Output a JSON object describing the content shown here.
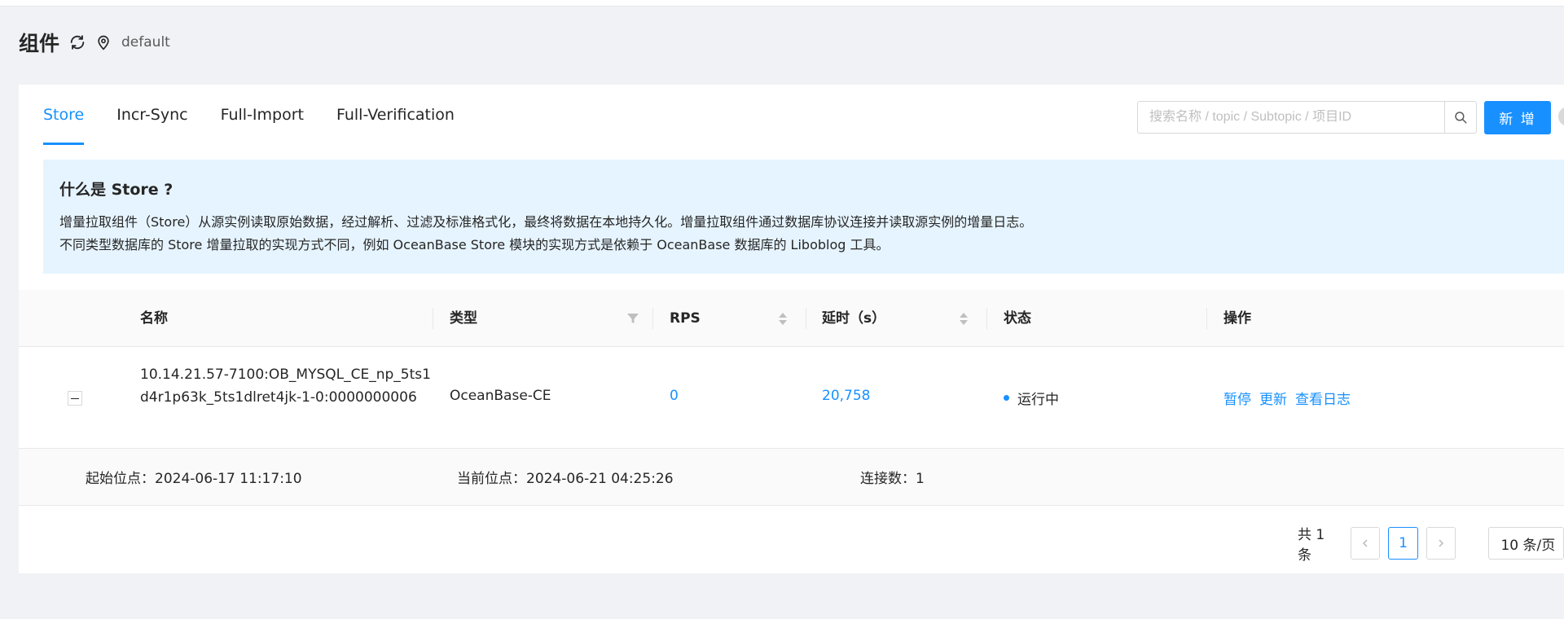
{
  "header": {
    "title": "组件",
    "refresh_icon": "refresh-icon",
    "location_icon": "location-pin-icon",
    "environment": "default"
  },
  "tabs": [
    {
      "label": "Store",
      "active": true
    },
    {
      "label": "Incr-Sync",
      "active": false
    },
    {
      "label": "Full-Import",
      "active": false
    },
    {
      "label": "Full-Verification",
      "active": false
    }
  ],
  "search": {
    "placeholder": "搜索名称 / topic / Subtopic / 项目ID",
    "value": "",
    "icon": "search-icon"
  },
  "add_button": {
    "label": "新 增"
  },
  "info": {
    "title": "什么是 Store ?",
    "line1": "增量拉取组件（Store）从源实例读取原始数据，经过解析、过滤及标准格式化，最终将数据在本地持久化。增量拉取组件通过数据库协议连接并读取源实例的增量日志。",
    "line2": "不同类型数据库的 Store 增量拉取的实现方式不同，例如 OceanBase Store 模块的实现方式是依赖于 OceanBase 数据库的 Liboblog 工具。"
  },
  "table": {
    "columns": {
      "name": "名称",
      "type": "类型",
      "rps": "RPS",
      "delay": "延时（s）",
      "status": "状态",
      "actions": "操作"
    },
    "rows": [
      {
        "name": "10.14.21.57-7100:OB_MYSQL_CE_np_5ts1d4r1p63k_5ts1dlret4jk-1-0:0000000006",
        "type": "OceanBase-CE",
        "rps": "0",
        "delay": "20,758",
        "status": "运行中",
        "actions": [
          "暂停",
          "更新",
          "查看日志"
        ],
        "expanded": true,
        "detail": {
          "start_pos": "起始位点：2024-06-17 11:17:10",
          "current_pos": "当前位点：2024-06-21 04:25:26",
          "connections": "连接数：1"
        }
      }
    ]
  },
  "pagination": {
    "total": "共 1 条",
    "current_page": "1",
    "page_size": "10 条/页"
  },
  "colors": {
    "primary": "#1890ff",
    "info_bg": "#e6f4ff",
    "page_bg": "#f0f2f5"
  }
}
